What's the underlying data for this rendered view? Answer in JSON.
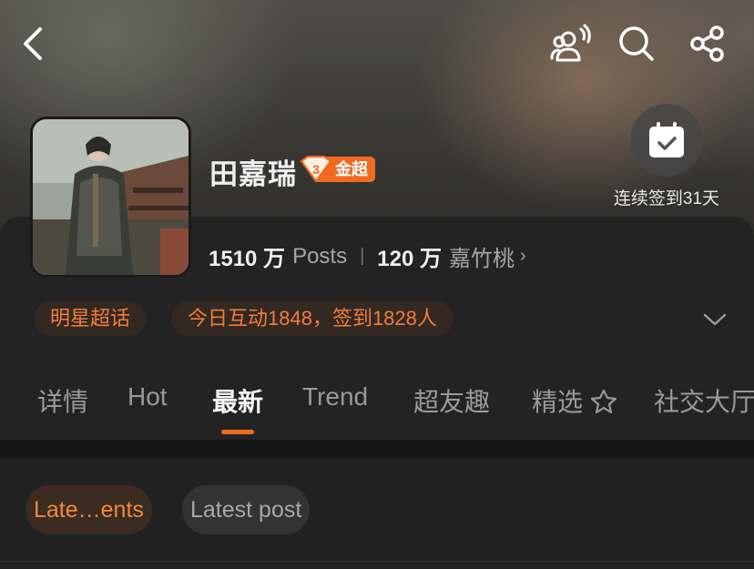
{
  "header": {
    "back_icon": "chevron-left-icon",
    "voice_icon": "group-voice-icon",
    "search_icon": "search-icon",
    "share_icon": "share-icon"
  },
  "profile": {
    "name": "田嘉瑞",
    "badge_level": "3",
    "badge_label": "金超",
    "checkin_label": "连续签到31天",
    "checkin_icon": "calendar-check-icon"
  },
  "stats": {
    "posts_value": "1510 万",
    "posts_label": "Posts",
    "fans_value": "120 万",
    "fans_label": "嘉竹桃",
    "chevron": "›"
  },
  "chips": {
    "category": "明星超话",
    "activity": "今日互动1848，签到1828人"
  },
  "tabs": [
    {
      "label": "详情"
    },
    {
      "label": "Hot"
    },
    {
      "label": "最新"
    },
    {
      "label": "Trend"
    },
    {
      "label": "超友趣"
    },
    {
      "label": "精选"
    },
    {
      "label": "社交大厅"
    }
  ],
  "active_tab": "最新",
  "sort": {
    "option1": "Late…ents",
    "option2": "Latest post"
  },
  "colors": {
    "accent": "#f06a22",
    "background": "#1f1f1f",
    "card": "#232323"
  }
}
